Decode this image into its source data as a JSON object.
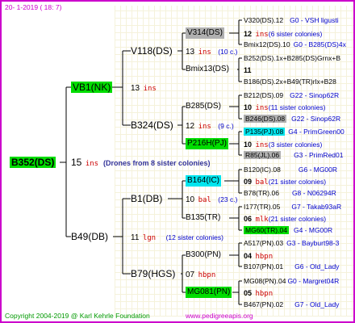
{
  "header": {
    "date": "20-   1-2019 (  18:   7)"
  },
  "footer": {
    "copyright": "Copyright 2004-2019 @ Karl Kehrle Foundation",
    "site": "www.pedigreeapis.org"
  },
  "root": {
    "id": "B352(DS)",
    "ins": "15",
    "ins_label": "ins",
    "drones_note": "(Drones from 8 sister colonies)"
  },
  "gen1": [
    {
      "id": "VB1(NK)"
    },
    {
      "id": "B49(DB)"
    }
  ],
  "gen1_ins": [
    {
      "n": "13",
      "label": "ins",
      "note": ""
    },
    {
      "n": "11",
      "label": "lgn",
      "note": "(12 sister colonies)"
    }
  ],
  "gen2": [
    {
      "id": "V118(DS)"
    },
    {
      "id": "B324(DS)"
    },
    {
      "id": "B1(DB)"
    },
    {
      "id": "B79(HGS)"
    }
  ],
  "gen2_ins": [
    {
      "n": "13",
      "label": "ins",
      "note": "(10 c.)"
    },
    {
      "n": "12",
      "label": "ins",
      "note": "(9 c.)"
    },
    {
      "n": "10",
      "label": "bal",
      "note": "(23 c.)"
    },
    {
      "n": "07",
      "label": "hbpn",
      "note": ""
    }
  ],
  "gen3": [
    {
      "id": "V314(DS)"
    },
    {
      "id": "Bmix13(DS)"
    },
    {
      "id": "B285(DS)"
    },
    {
      "id": "P216H(PJ)"
    },
    {
      "id": "B164(IC)"
    },
    {
      "id": "B135(TR)"
    },
    {
      "id": "B300(PN)"
    },
    {
      "id": "MG081(PN)"
    }
  ],
  "gen3_ins": [
    {
      "n": "12",
      "label": "ins",
      "note": "(6 sister colonies)"
    },
    {
      "n": "11",
      "label": "",
      "note": ""
    },
    {
      "n": "10",
      "label": "ins",
      "note": "(11 sister colonies)"
    },
    {
      "n": "10",
      "label": "ins",
      "note": "(3 sister colonies)"
    },
    {
      "n": "09",
      "label": "bal",
      "note": "(21 sister colonies)"
    },
    {
      "n": "06",
      "label": "mlk",
      "note": "(21 sister colonies)"
    },
    {
      "n": "04",
      "label": "hbpn",
      "note": ""
    },
    {
      "n": "05",
      "label": "hbpn",
      "note": ""
    }
  ],
  "gen4": [
    {
      "id": "V320(DS).12",
      "note": "G0 - VSH ligusti"
    },
    {
      "id": "Bmix12(DS).10",
      "note": "G0 - B285(DS)4x"
    },
    {
      "id": "B252(DS).1x+B285(DS)Grnx+B",
      "note": ""
    },
    {
      "id": "B186(DS).2x+B49(TR)rlx+B28",
      "note": ""
    },
    {
      "id": "B212(DS).09",
      "note": "G22 - Sinop62R"
    },
    {
      "id": "B246(DS).08",
      "note": "G22 - Sinop62R"
    },
    {
      "id": "P135(PJ).08",
      "note": "G4 - PrimGreen00"
    },
    {
      "id": "R85(JL).06",
      "note": "G3 - PrimRed01"
    },
    {
      "id": "B120(IC).08",
      "note": "G6 - MG00R"
    },
    {
      "id": "B78(TR).06",
      "note": "G8 - N06294R"
    },
    {
      "id": "I177(TR).05",
      "note": "G7 - Takab93aR"
    },
    {
      "id": "MG60(TR).04",
      "note": "G4 - MG00R"
    },
    {
      "id": "A517(PN).03",
      "note": "G3 - Bayburt98-3"
    },
    {
      "id": "B107(PN).01",
      "note": "G6 - Old_Lady"
    },
    {
      "id": "MG08(PN).04",
      "note": "G0 - Margret04R"
    },
    {
      "id": "B467(PN).02",
      "note": "G7 - Old_Lady"
    }
  ],
  "colors": {
    "border": "#cc00cc",
    "highlight_green": "#00dd00",
    "highlight_gray": "#b0b0b0",
    "highlight_cyan": "#00e5ee",
    "ins_red": "#cc0000",
    "note_blue": "#0000cc"
  }
}
